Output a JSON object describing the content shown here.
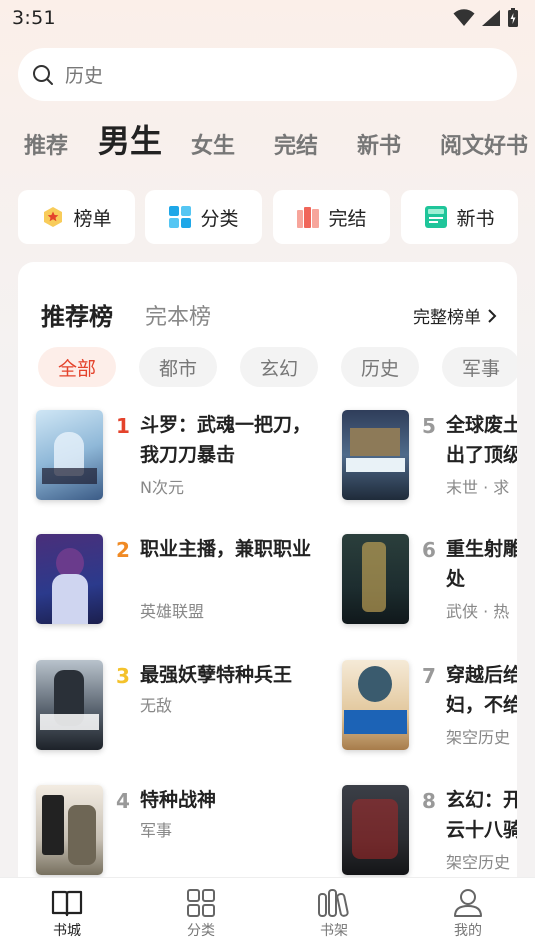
{
  "status": {
    "time": "3:51"
  },
  "search": {
    "placeholder": "历史"
  },
  "channels": [
    "推荐",
    "男生",
    "女生",
    "完结",
    "新书",
    "阅文好书"
  ],
  "shortcuts": [
    {
      "label": "榜单",
      "icon": "crown-badge-icon",
      "color": "#f5a623"
    },
    {
      "label": "分类",
      "icon": "grid-icon",
      "color": "#1ea7e8"
    },
    {
      "label": "完结",
      "icon": "book-stack-icon",
      "color": "#f0665a"
    },
    {
      "label": "新书",
      "icon": "new-doc-icon",
      "color": "#1fc59a"
    }
  ],
  "rank": {
    "active_tab": "推荐榜",
    "tab2": "完本榜",
    "full_link": "完整榜单"
  },
  "filters": [
    "全部",
    "都市",
    "玄幻",
    "历史",
    "军事"
  ],
  "books_left": [
    {
      "rank": "1",
      "title": "斗罗：武魂一把刀，我刀刀暴击",
      "tag": "N次元",
      "rank_color": "#e4432c"
    },
    {
      "rank": "2",
      "title": "职业主播，兼职职业",
      "tag": "英雄联盟",
      "rank_color": "#f08a24"
    },
    {
      "rank": "3",
      "title": "最强妖孽特种兵王",
      "tag": "无敌",
      "rank_color": "#f4c22b"
    },
    {
      "rank": "4",
      "title": "特种战神",
      "tag": "军事",
      "rank_color": "#999999"
    }
  ],
  "books_right": [
    {
      "rank": "5",
      "title": "全球废土出了顶级",
      "tag": "末世 · 求",
      "rank_color": "#999999"
    },
    {
      "rank": "6",
      "title": "重生射雕处",
      "tag": "武侠 · 热",
      "rank_color": "#999999"
    },
    {
      "rank": "7",
      "title": "穿越后给妇，不给",
      "tag": "架空历史",
      "rank_color": "#999999"
    },
    {
      "rank": "8",
      "title": "玄幻：开云十八骑",
      "tag": "架空历史",
      "rank_color": "#999999"
    }
  ],
  "nav": [
    {
      "label": "书城",
      "icon": "open-book-icon",
      "active": true
    },
    {
      "label": "分类",
      "icon": "grid-squares-icon",
      "active": false
    },
    {
      "label": "书架",
      "icon": "bookshelf-icon",
      "active": false
    },
    {
      "label": "我的",
      "icon": "person-icon",
      "active": false
    }
  ],
  "colors": {
    "accent": "#e4432c",
    "text": "#222222",
    "muted": "#888888"
  }
}
